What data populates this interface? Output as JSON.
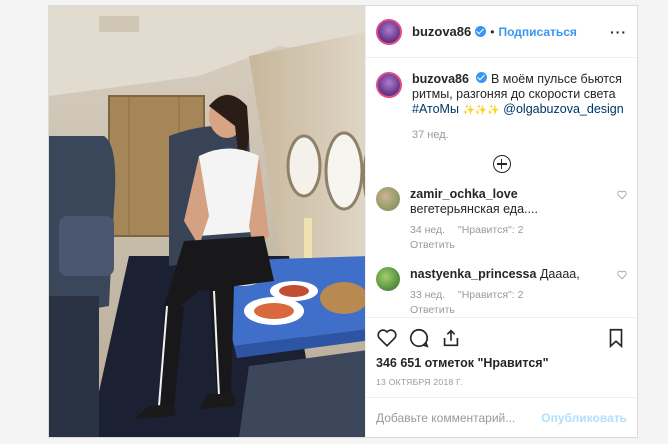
{
  "post": {
    "username": "buzova86",
    "follow_label": "Подписаться",
    "dot": "•",
    "caption_line": "В моём пульсе бьются ритмы, разгоняя до скорости света",
    "caption_hashtag": "#АтоМы",
    "caption_sparkles": "✨✨✨",
    "caption_mention": "@olgabuzova_design",
    "caption_age": "37 нед.",
    "likes": "346 651 отметок \"Нравится\"",
    "date": "13 ОКТЯБРЯ 2018 Г.",
    "comment_placeholder": "Добавьте комментарий...",
    "publish_label": "Опубликовать"
  },
  "comments": [
    {
      "user": "zamir_ochka_love",
      "text": "вегетерьянская еда....",
      "age": "34 нед.",
      "likes": "\"Нравится\": 2",
      "reply": "Ответить"
    },
    {
      "user": "nastyenka_princessa",
      "text": "Даааа,",
      "age": "33 нед.",
      "likes": "\"Нравится\": 2",
      "reply": "Ответить"
    }
  ],
  "icons": {
    "verified": "verified-badge-icon",
    "more": "more-options-icon",
    "load_more": "plus-circle-icon",
    "like": "heart-icon",
    "comment": "comment-icon",
    "share": "share-icon",
    "save": "bookmark-icon"
  },
  "colors": {
    "link": "#3897f0",
    "border": "#dbdbdb",
    "muted": "#999999"
  }
}
